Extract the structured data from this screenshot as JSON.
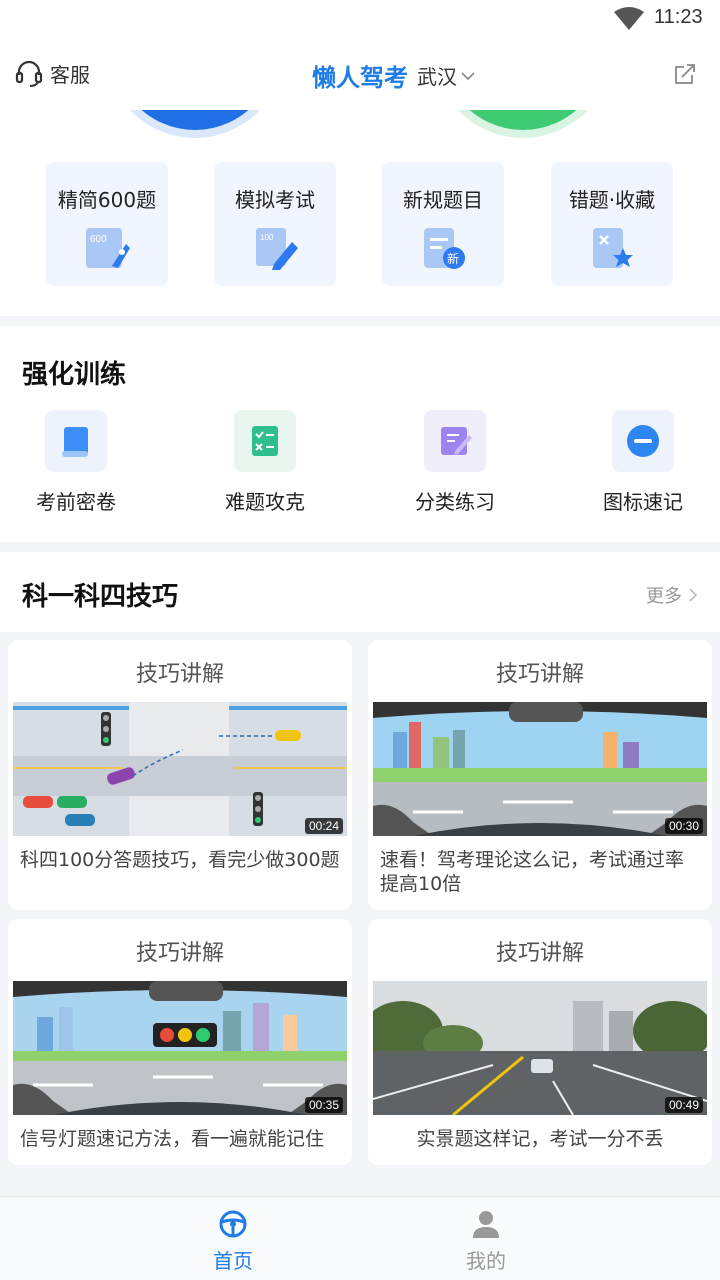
{
  "status_bar": {
    "time": "11:23"
  },
  "header": {
    "customer_service": "客服",
    "brand": "懒人驾考",
    "city": "武汉"
  },
  "quick_cards": [
    {
      "label": "精简600题",
      "icon": "600-rocket-icon"
    },
    {
      "label": "模拟考试",
      "icon": "exam-pencil-icon"
    },
    {
      "label": "新规题目",
      "icon": "new-rules-icon"
    },
    {
      "label": "错题·收藏",
      "icon": "wrong-favorite-icon"
    }
  ],
  "strengthen": {
    "title": "强化训练",
    "items": [
      {
        "label": "考前密卷",
        "icon": "scroll-icon"
      },
      {
        "label": "难题攻克",
        "icon": "checklist-icon"
      },
      {
        "label": "分类练习",
        "icon": "edit-note-icon"
      },
      {
        "label": "图标速记",
        "icon": "minus-circle-icon"
      }
    ]
  },
  "tips": {
    "title": "科一科四技巧",
    "more": "更多",
    "videos": [
      {
        "tag": "技巧讲解",
        "duration": "00:24",
        "desc": "科四100分答题技巧，看完少做300题"
      },
      {
        "tag": "技巧讲解",
        "duration": "00:30",
        "desc": "速看！驾考理论这么记，考试通过率提高10倍"
      },
      {
        "tag": "技巧讲解",
        "duration": "00:35",
        "desc": "信号灯题速记方法，看一遍就能记住"
      },
      {
        "tag": "技巧讲解",
        "duration": "00:49",
        "desc": "实景题这样记，考试一分不丢"
      }
    ]
  },
  "bottom_nav": {
    "home": "首页",
    "mine": "我的"
  },
  "colors": {
    "brand_blue": "#1e7ce8",
    "accent_green": "#3fcb74",
    "inactive": "#999999"
  }
}
